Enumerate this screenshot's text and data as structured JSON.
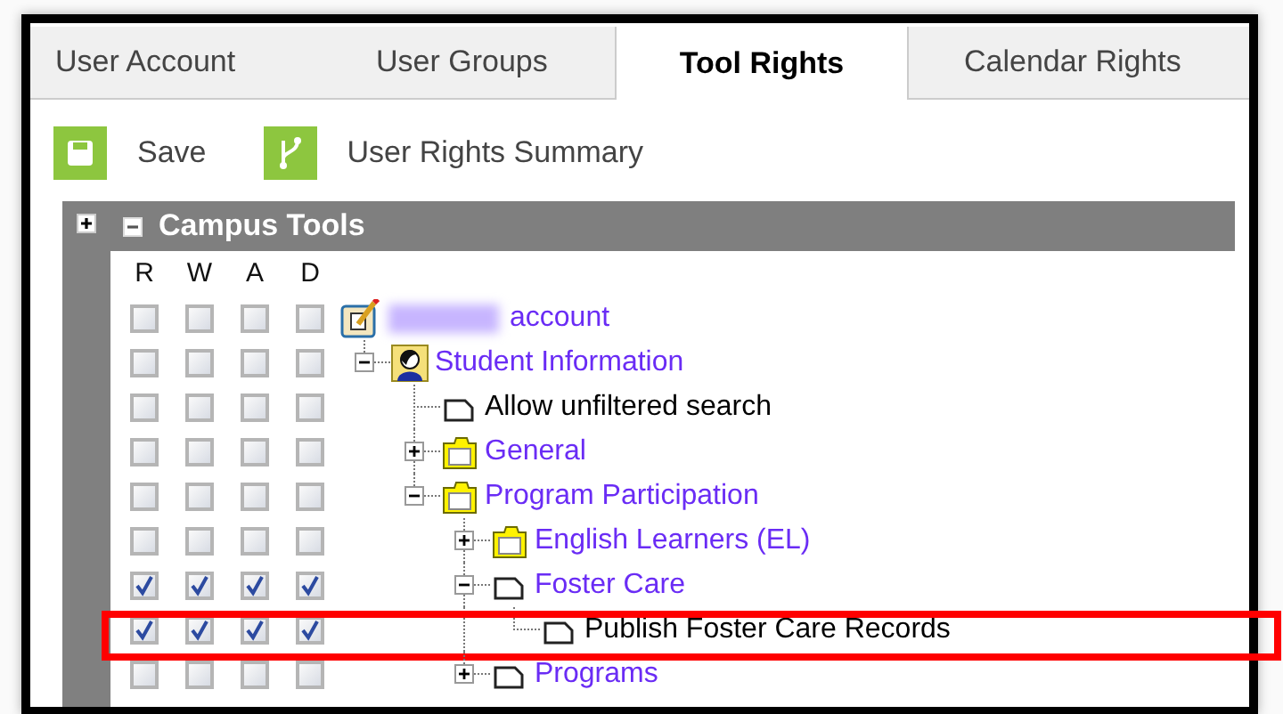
{
  "tabs": [
    {
      "label": "User Account",
      "selected": false
    },
    {
      "label": "User Groups",
      "selected": false
    },
    {
      "label": "Tool Rights",
      "selected": true
    },
    {
      "label": "Calendar Rights",
      "selected": false
    }
  ],
  "toolbar": [
    {
      "label": "Save",
      "kind": "save"
    },
    {
      "label": "User Rights Summary",
      "kind": "summary"
    }
  ],
  "panel": {
    "title": "Campus Tools",
    "expanded": true,
    "columns": [
      "R",
      "W",
      "A",
      "D"
    ],
    "tree": [
      {
        "label": "account",
        "redacted": true,
        "link": true,
        "kind": "account",
        "rights": [
          false,
          false,
          false,
          false
        ],
        "children": [
          {
            "label": "Student Information",
            "link": true,
            "kind": "person",
            "expanded": true,
            "rights": [
              false,
              false,
              false,
              false
            ],
            "children": [
              {
                "label": "Allow unfiltered search",
                "link": false,
                "kind": "page",
                "rights": [
                  false,
                  false,
                  false,
                  false
                ]
              },
              {
                "label": "General",
                "link": true,
                "kind": "folder",
                "expanded": false,
                "rights": [
                  false,
                  false,
                  false,
                  false
                ]
              },
              {
                "label": "Program Participation",
                "link": true,
                "kind": "folder",
                "expanded": true,
                "rights": [
                  false,
                  false,
                  false,
                  false
                ],
                "children": [
                  {
                    "label": "English Learners (EL)",
                    "link": true,
                    "kind": "folder",
                    "expanded": false,
                    "rights": [
                      false,
                      false,
                      false,
                      false
                    ]
                  },
                  {
                    "label": "Foster Care",
                    "link": true,
                    "kind": "page",
                    "expanded": true,
                    "rights": [
                      true,
                      true,
                      true,
                      true
                    ],
                    "children": [
                      {
                        "label": "Publish Foster Care Records",
                        "link": false,
                        "kind": "page",
                        "highlighted": true,
                        "rights": [
                          true,
                          true,
                          true,
                          true
                        ]
                      }
                    ]
                  },
                  {
                    "label": "Programs",
                    "link": true,
                    "kind": "page",
                    "expanded": false,
                    "rights": [
                      false,
                      false,
                      false,
                      false
                    ]
                  }
                ]
              }
            ]
          }
        ]
      }
    ]
  }
}
